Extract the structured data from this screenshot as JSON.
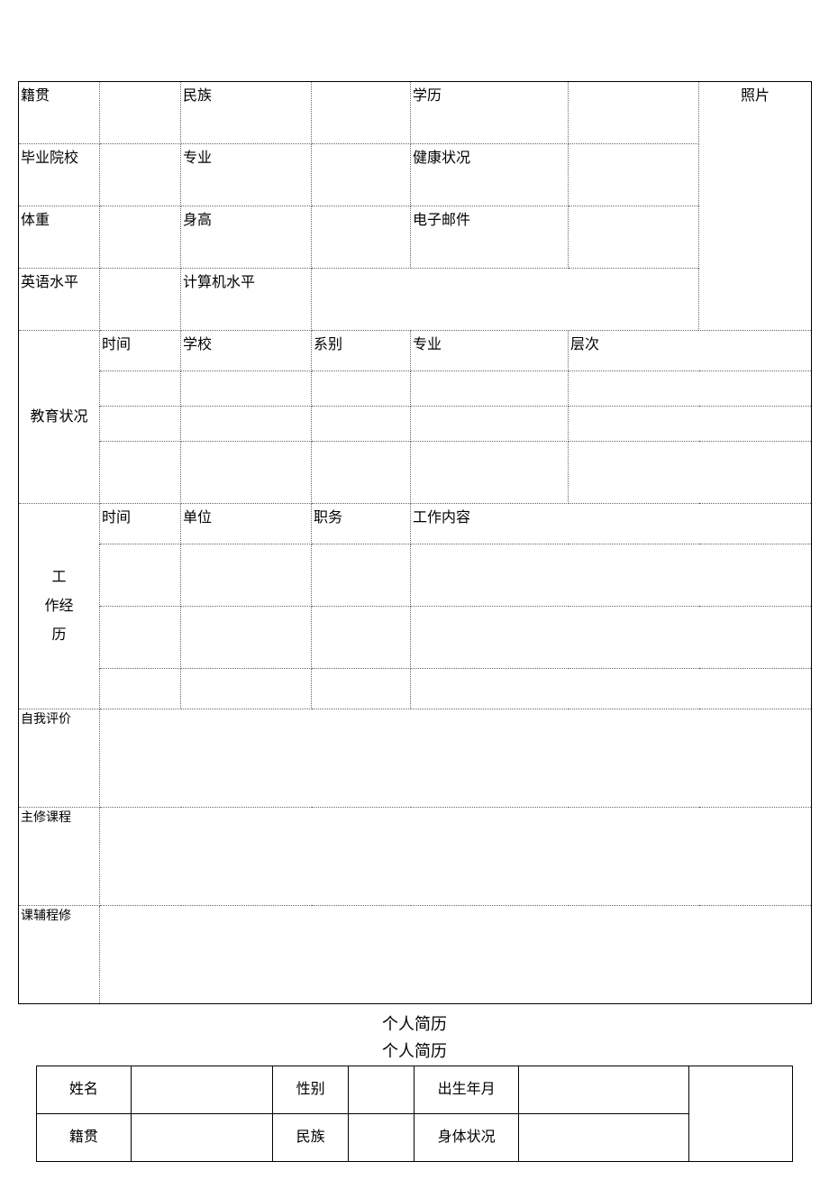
{
  "table1": {
    "row1": {
      "c1": "籍贯",
      "c3": "民族",
      "c5": "学历",
      "c7": "照片"
    },
    "row2": {
      "c1": "毕业院校",
      "c3": "专业",
      "c5": "健康状况"
    },
    "row3": {
      "c1": "体重",
      "c3": "身高",
      "c5": "电子邮件"
    },
    "row4": {
      "c1": "英语水平",
      "c3": "计算机水平"
    },
    "edu": {
      "label": "教育状况",
      "headers": {
        "time": "时间",
        "school": "学校",
        "dept": "系别",
        "major": "专业",
        "level": "层次"
      }
    },
    "work": {
      "label": "工作经历",
      "label_line1": "工",
      "label_line2": "作经",
      "label_line3": "历",
      "headers": {
        "time": "时间",
        "unit": "单位",
        "post": "职务",
        "content": "工作内容"
      }
    },
    "self_eval": "自我评价",
    "main_course": "主修课程",
    "aux_course": "课辅程修"
  },
  "title1": "个人简历",
  "title2": "个人简历",
  "table2": {
    "r1": {
      "c1": "姓名",
      "c3": "性别",
      "c5": "出生年月"
    },
    "r2": {
      "c1": "籍贯",
      "c3": "民族",
      "c5": "身体状况"
    }
  }
}
